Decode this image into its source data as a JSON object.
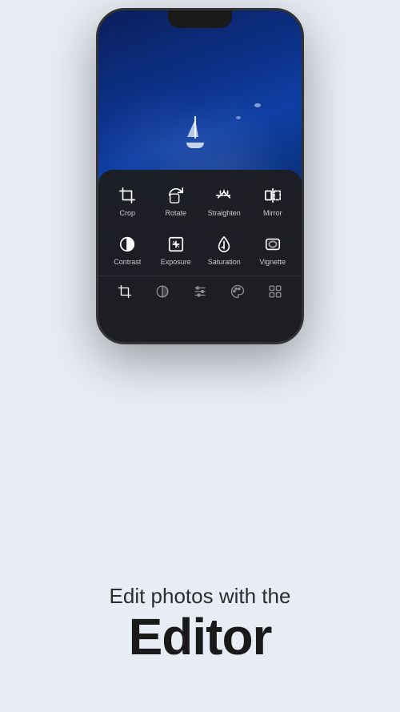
{
  "phone": {
    "tools_row1": [
      {
        "id": "crop",
        "label": "Crop",
        "icon": "crop"
      },
      {
        "id": "rotate",
        "label": "Rotate",
        "icon": "rotate"
      },
      {
        "id": "straighten",
        "label": "Straighten",
        "icon": "straighten"
      },
      {
        "id": "mirror",
        "label": "Mirror",
        "icon": "mirror"
      }
    ],
    "tools_row2": [
      {
        "id": "contrast",
        "label": "Contrast",
        "icon": "contrast"
      },
      {
        "id": "exposure",
        "label": "Exposure",
        "icon": "exposure"
      },
      {
        "id": "saturation",
        "label": "Saturation",
        "icon": "saturation"
      },
      {
        "id": "vignette",
        "label": "Vignette",
        "icon": "vignette"
      }
    ],
    "nav_icons": [
      "crop-nav",
      "lock-nav",
      "sliders-nav",
      "palette-nav",
      "grid-nav"
    ]
  },
  "text": {
    "subtitle": "Edit photos with the",
    "title": "Editor"
  }
}
